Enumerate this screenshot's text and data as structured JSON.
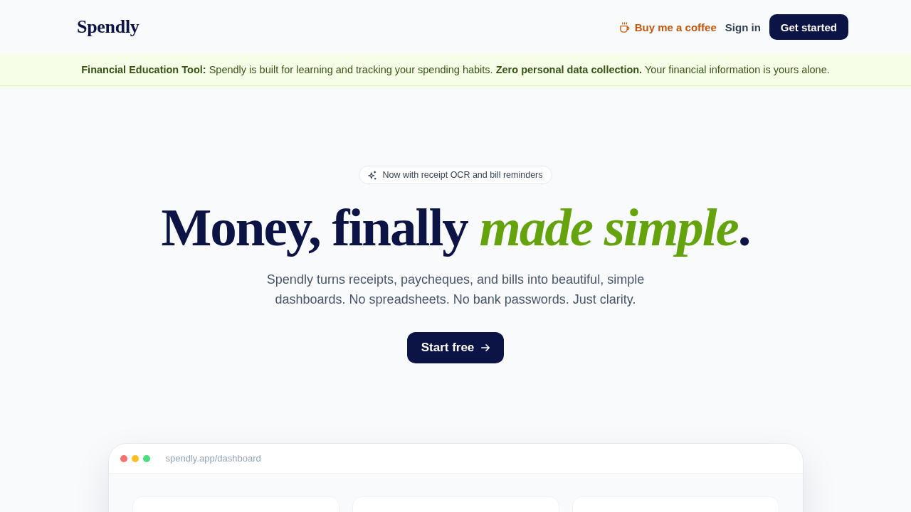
{
  "nav": {
    "logo": "Spendly",
    "links": [
      {
        "kind": "coffee",
        "label": "Buy me a coffee"
      },
      {
        "kind": "text",
        "label": "Sign in"
      },
      {
        "kind": "primary",
        "label": "Get started"
      }
    ]
  },
  "notice_banner": {
    "text": "**Financial Education Tool:** Spendly is built for learning and tracking your spending habits. **Zero personal data collection.** Your financial information is yours alone."
  },
  "hero": {
    "badge": "Now with receipt OCR and bill reminders",
    "headline": "Money, finally *made simple*.",
    "subtitle": "Spendly turns receipts, paycheques, and bills into beautiful, simple dashboards. No spreadsheets. No bank passwords. Just clarity.",
    "cta": "Start free"
  },
  "preview_window": {
    "window_dots": [
      {
        "color": "#f87171"
      },
      {
        "color": "#fbbf24"
      },
      {
        "color": "#4ade80"
      }
    ],
    "url": "spendly.app/dashboard"
  }
}
